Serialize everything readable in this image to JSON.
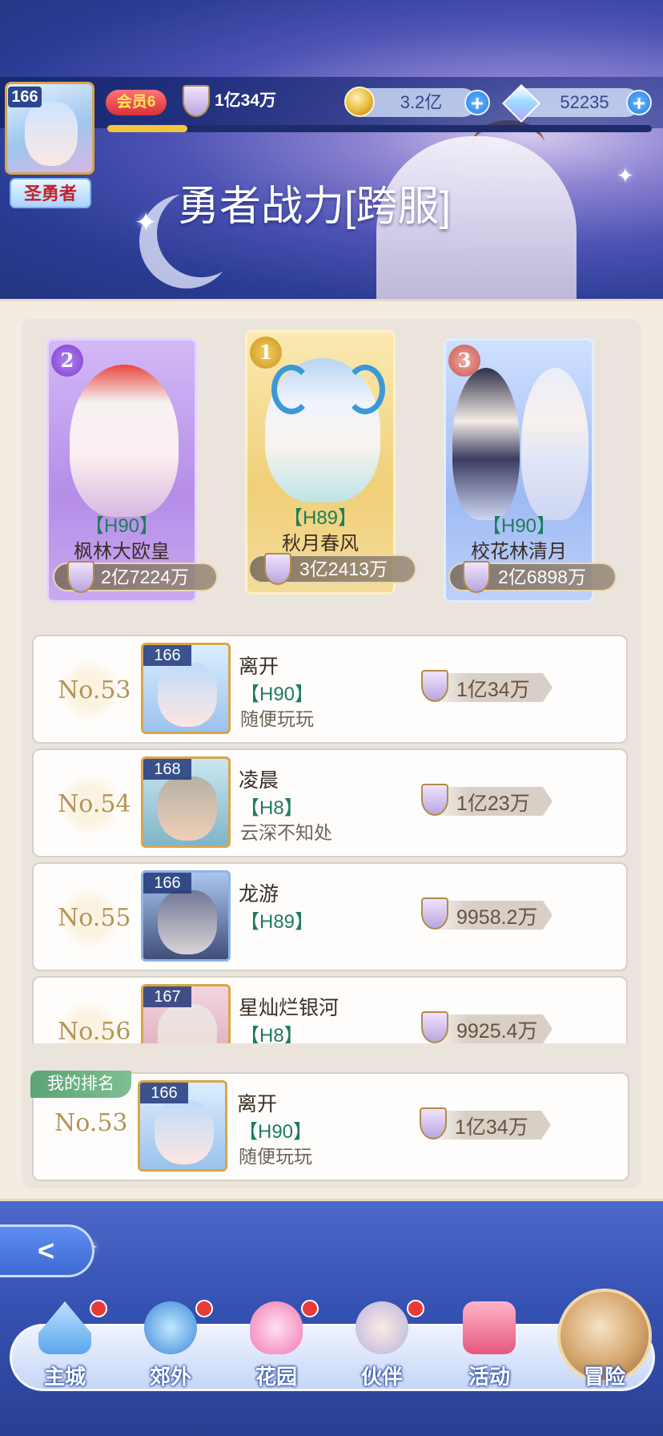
{
  "header": {
    "player_level": "166",
    "player_title": "圣勇者",
    "vip": "会员6",
    "power": "1亿34万",
    "coins": "3.2亿",
    "gems": "52235",
    "plus": "+",
    "page_title": "勇者战力[跨服]"
  },
  "top3": [
    {
      "rank": "2",
      "level": "【H90】",
      "name": "枫林大欧皇",
      "power": "2亿7224万"
    },
    {
      "rank": "1",
      "level": "【H89】",
      "name": "秋月春风",
      "power": "3亿2413万"
    },
    {
      "rank": "3",
      "level": "【H90】",
      "name": "校花林清月",
      "power": "2亿6898万"
    }
  ],
  "ranking": [
    {
      "no": "No.53",
      "portrait_level": "166",
      "name": "离开",
      "level": "【H90】",
      "guild": "随便玩玩",
      "power": "1亿34万"
    },
    {
      "no": "No.54",
      "portrait_level": "168",
      "name": "凌晨",
      "level": "【H8】",
      "guild": "云深不知处",
      "power": "1亿23万"
    },
    {
      "no": "No.55",
      "portrait_level": "166",
      "name": "龙游",
      "level": "【H89】",
      "guild": "",
      "power": "9958.2万"
    },
    {
      "no": "No.56",
      "portrait_level": "167",
      "name": "星灿烂银河",
      "level": "【H8】",
      "guild": "",
      "power": "9925.4万"
    }
  ],
  "my_rank": {
    "tag": "我的排名",
    "no": "No.53",
    "portrait_level": "166",
    "name": "离开",
    "level": "【H90】",
    "guild": "随便玩玩",
    "power": "1亿34万"
  },
  "nav": {
    "back": "<",
    "items": [
      {
        "label": "主城"
      },
      {
        "label": "郊外"
      },
      {
        "label": "花园"
      },
      {
        "label": "伙伴"
      },
      {
        "label": "活动"
      },
      {
        "label": "冒险"
      }
    ]
  }
}
